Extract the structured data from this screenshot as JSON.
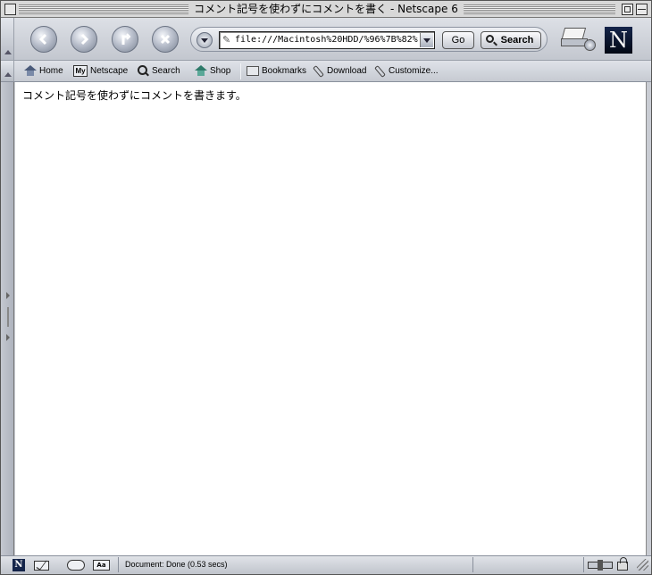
{
  "window": {
    "title": "コメント記号を使わずにコメントを書く - Netscape 6"
  },
  "navbar": {
    "back_icon": "arrow-left-icon",
    "forward_icon": "arrow-right-icon",
    "reload_icon": "reload-icon",
    "stop_icon": "stop-x-icon",
    "url_value": "file:///Macintosh%20HDD/%96%7B%82%",
    "go_label": "Go",
    "search_label": "Search"
  },
  "personal_toolbar": {
    "items": [
      {
        "label": "Home",
        "icon": "home-icon"
      },
      {
        "label": "Netscape",
        "icon": "my-netscape-icon",
        "icon_text": "My"
      },
      {
        "label": "Search",
        "icon": "search-icon"
      },
      {
        "label": "Shop",
        "icon": "shop-icon"
      },
      {
        "label": "Bookmarks",
        "icon": "folder-icon"
      },
      {
        "label": "Download",
        "icon": "link-icon"
      },
      {
        "label": "Customize...",
        "icon": "link-icon"
      }
    ]
  },
  "content": {
    "text": "コメント記号を使わずにコメントを書きます。"
  },
  "statusbar": {
    "status_text": "Document: Done (0.53 secs)",
    "composer_icon_text": "Aa"
  },
  "colors": {
    "chrome": "#c9ccd3",
    "logo_bg": "#14244a",
    "content_bg": "#ffffff"
  }
}
